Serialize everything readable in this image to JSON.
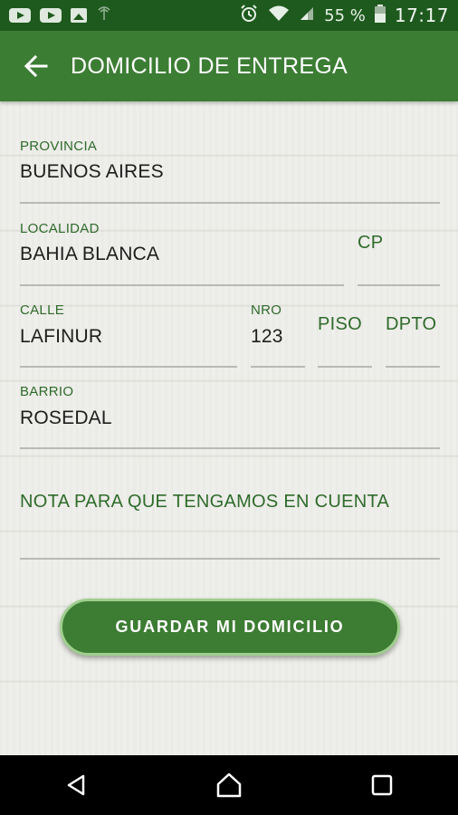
{
  "status_bar": {
    "battery_percent": "55 %",
    "time": "17:17",
    "icons": [
      "youtube-icon",
      "youtube-icon",
      "image-icon",
      "signal-icon",
      "alarm-icon",
      "wifi-icon",
      "cell-signal-icon",
      "battery-icon"
    ]
  },
  "app_bar": {
    "title": "DOMICILIO DE ENTREGA",
    "back_icon": "arrow-left-icon"
  },
  "form": {
    "provincia": {
      "label": "PROVINCIA",
      "value": "BUENOS AIRES"
    },
    "localidad": {
      "label": "LOCALIDAD",
      "value": "BAHIA BLANCA"
    },
    "cp": {
      "label": "CP",
      "value": ""
    },
    "calle": {
      "label": "CALLE",
      "value": "LAFINUR"
    },
    "nro": {
      "label": "NRO",
      "value": "123"
    },
    "piso": {
      "label": "PISO",
      "value": ""
    },
    "dpto": {
      "label": "DPTO",
      "value": ""
    },
    "barrio": {
      "label": "BARRIO",
      "value": "ROSEDAL"
    },
    "nota": {
      "label": "NOTA PARA QUE TENGAMOS EN CUENTA",
      "value": ""
    }
  },
  "save_button": {
    "label": "GUARDAR MI DOMICILIO"
  },
  "nav_bar": {
    "icons": [
      "back-triangle-icon",
      "home-icon",
      "recents-square-icon"
    ]
  },
  "colors": {
    "status_bar": "#1e5a1e",
    "app_bar": "#3c7d34",
    "accent_text": "#2f6b2b",
    "button": "#3d7c33",
    "button_border": "#9fce8e"
  }
}
